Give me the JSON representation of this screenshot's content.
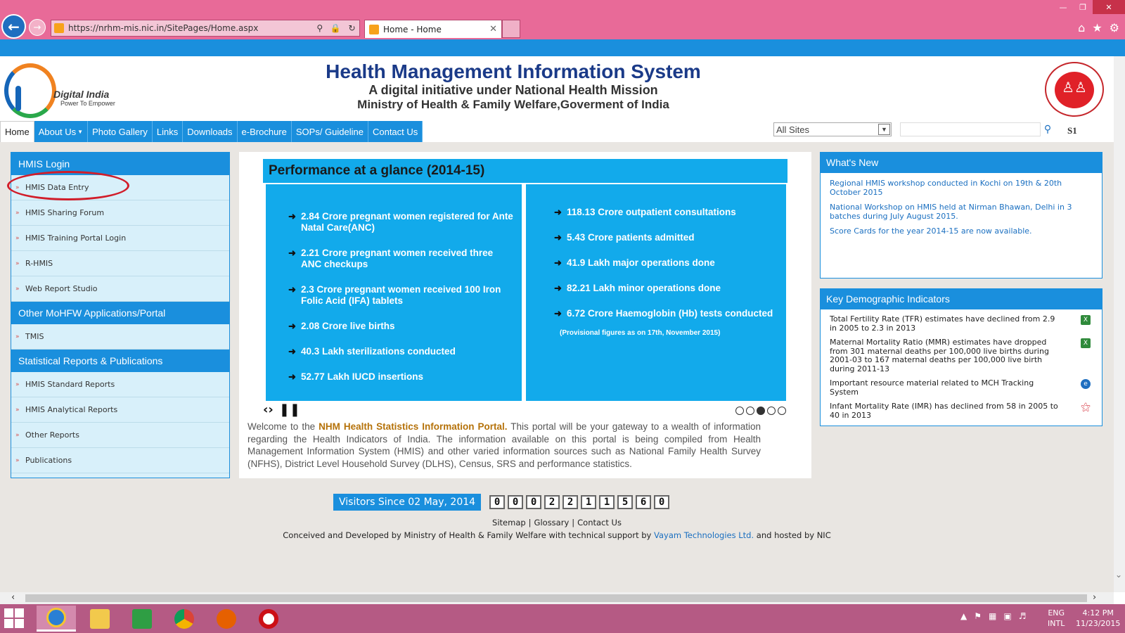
{
  "browser": {
    "url": "https://nrhm-mis.nic.in/SitePages/Home.aspx",
    "tab_title": "Home - Home"
  },
  "header": {
    "logo_left_name": "Digital India",
    "logo_left_tagline": "Power To Empower",
    "title": "Health Management Information System",
    "subtitle1": "A digital initiative under National Health Mission",
    "subtitle2": "Ministry of Health & Family Welfare,Goverment of India"
  },
  "nav": {
    "items": [
      "Home",
      "About Us",
      "Photo Gallery",
      "Links",
      "Downloads",
      "e-Brochure",
      "SOPs/ Guideline",
      "Contact Us"
    ],
    "site_select": "All Sites",
    "user_label": "S1"
  },
  "left_panel": {
    "sections": [
      {
        "title": "HMIS Login",
        "items": [
          "HMIS Data Entry",
          "HMIS Sharing Forum",
          "HMIS Training Portal Login",
          "R-HMIS",
          "Web Report Studio"
        ]
      },
      {
        "title": "Other MoHFW Applications/Portal",
        "items": [
          "TMIS"
        ]
      },
      {
        "title": "Statistical Reports & Publications",
        "items": [
          "HMIS Standard Reports",
          "HMIS Analytical Reports",
          "Other Reports",
          "Publications"
        ]
      }
    ]
  },
  "performance": {
    "title": "Performance at a glance (2014-15)",
    "left": [
      "2.84 Crore pregnant women registered for Ante Natal Care(ANC)",
      "2.21 Crore pregnant women received three ANC checkups",
      "2.3 Crore pregnant women received 100 Iron Folic Acid (IFA) tablets",
      "2.08 Crore live births",
      "40.3 Lakh sterilizations conducted",
      "52.77 Lakh IUCD insertions"
    ],
    "right": [
      "118.13 Crore outpatient consultations",
      "5.43 Crore patients admitted",
      "41.9 Lakh major operations done",
      "82.21 Lakh minor operations done",
      "6.72 Crore Haemoglobin (Hb) tests conducted"
    ],
    "note": "(Provisional figures as on 17th, November 2015)",
    "active_slide": 3,
    "slide_count": 5
  },
  "welcome": {
    "prefix": "Welcome to the ",
    "portal_name": "NHM Health Statistics Information Portal.",
    "body": " This portal will be your gateway to a wealth of information regarding the Health Indicators of India. The information available on this portal is being compiled from Health Management Information System (HMIS) and other varied information sources such as National Family Health Survey (NFHS), District Level Household Survey (DLHS), Census, SRS and performance statistics."
  },
  "whats_new": {
    "title": "What's New",
    "items": [
      "Regional HMIS workshop conducted in Kochi on 19th & 20th October 2015",
      "National Workshop on HMIS held at Nirman Bhawan, Delhi in 3 batches during July August 2015.",
      "Score Cards for the year 2014-15 are now available."
    ]
  },
  "kdi": {
    "title": "Key Demographic Indicators",
    "items": [
      {
        "text": "Total Fertility Rate (TFR)  estimates have declined from 2.9 in 2005 to 2.3 in 2013",
        "icon": "excel-icon"
      },
      {
        "text": "Maternal Mortality Ratio (MMR) estimates have dropped from 301 maternal deaths per 100,000 live births during 2001-03 to 167 maternal deaths per 100,000 live birth during 2011-13",
        "icon": "excel-icon"
      },
      {
        "text": "Important resource material related to MCH Tracking System",
        "icon": "ie-icon"
      },
      {
        "text": "Infant Mortality Rate (IMR) has declined from 58 in 2005 to 40 in 2013",
        "icon": "pdf-icon"
      }
    ]
  },
  "footer": {
    "visitors_label": "Visitors Since 02 May, 2014",
    "visitor_digits": [
      "0",
      "0",
      "0",
      "2",
      "2",
      "1",
      "1",
      "5",
      "6",
      "0"
    ],
    "links": [
      "Sitemap",
      "Glossary",
      "Contact Us"
    ],
    "credits_prefix": "Conceived and Developed by Ministry of Health & Family Welfare with technical support by ",
    "credits_vendor": "Vayam Technologies Ltd.",
    "credits_suffix": " and hosted by NIC"
  },
  "taskbar": {
    "lang1": "ENG",
    "lang2": "INTL",
    "time": "4:12 PM",
    "date": "11/23/2015"
  }
}
